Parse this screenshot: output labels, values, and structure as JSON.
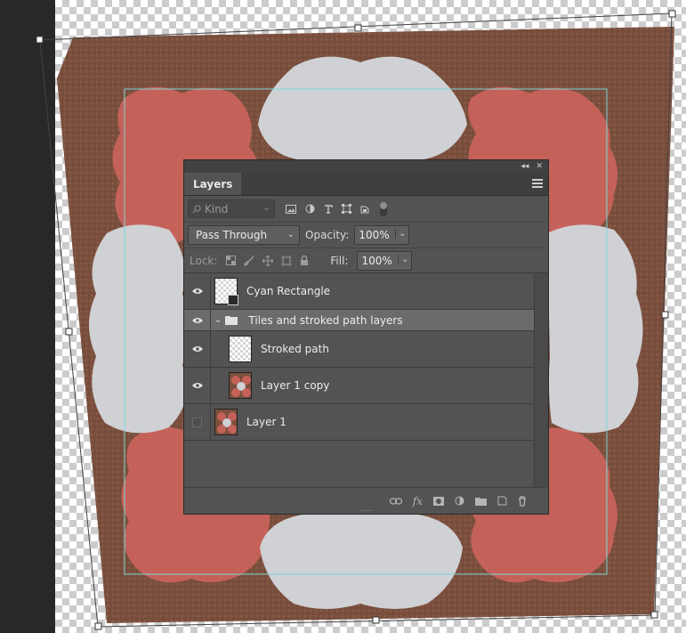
{
  "layers_panel": {
    "tab_label": "Layers",
    "filter": {
      "kind_placeholder": "Kind"
    },
    "blend_mode": "Pass Through",
    "opacity_label": "Opacity:",
    "opacity_value": "100%",
    "lock_label": "Lock:",
    "fill_label": "Fill:",
    "fill_value": "100%",
    "layers": [
      {
        "name": "Cyan Rectangle",
        "visible": true,
        "type": "shape"
      },
      {
        "name": "Tiles and stroked path layers",
        "visible": true,
        "type": "group",
        "expanded": true
      },
      {
        "name": "Stroked path",
        "visible": true,
        "type": "pixel",
        "in_group": true
      },
      {
        "name": "Layer 1 copy",
        "visible": true,
        "type": "photo",
        "in_group": true
      },
      {
        "name": "Layer 1",
        "visible": false,
        "type": "photo"
      }
    ]
  },
  "colors": {
    "guide_cyan": "#7fd6d6",
    "panel_bg": "#535353",
    "selected_row": "#6b6b6b",
    "tile_red": "#c8645a",
    "tile_grey": "#cdcfd2",
    "ground_brown": "#7a4e3c"
  }
}
